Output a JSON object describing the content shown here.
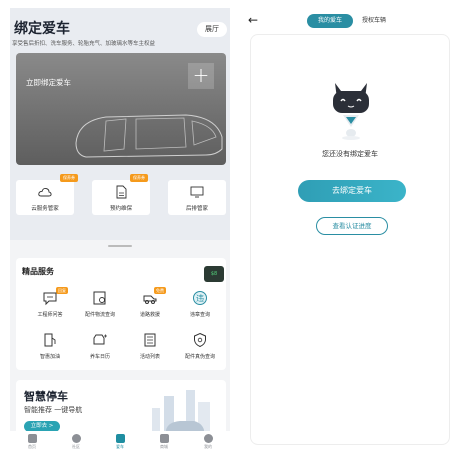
{
  "left": {
    "title": "绑定爱车",
    "subtitle": "享受售后折扣、洗车服务、轮胎充气、加玻璃水等车主权益",
    "hall_label": "展厅",
    "car_card_label": "立即绑定爱车",
    "services": [
      {
        "label": "云服务管家",
        "badge": "",
        "icon": "cloud-icon"
      },
      {
        "label": "预约维保",
        "badge": "保养券",
        "icon": "document-icon"
      },
      {
        "label": "后排管家",
        "badge": "",
        "icon": "monitor-icon"
      }
    ],
    "service_badge_left": "保养券",
    "premium_title": "精品服务",
    "premium_items": [
      {
        "label": "工程师问答",
        "icon": "chat-icon",
        "badge": "回复"
      },
      {
        "label": "配件物流查询",
        "icon": "parts-search-icon",
        "badge": ""
      },
      {
        "label": "道路救援",
        "icon": "tow-truck-icon",
        "badge": "免费"
      },
      {
        "label": "违章查询",
        "icon": "violation-icon",
        "badge": ""
      },
      {
        "label": "智惠加油",
        "icon": "fuel-icon",
        "badge": ""
      },
      {
        "label": "养车日历",
        "icon": "calendar-car-icon",
        "badge": ""
      },
      {
        "label": "活动列表",
        "icon": "list-icon",
        "badge": ""
      },
      {
        "label": "配件真伪查询",
        "icon": "shield-check-icon",
        "badge": ""
      }
    ],
    "float_chip": "$8",
    "parking": {
      "title": "智慧停车",
      "subtitle": "智能推荐 一键导航",
      "button": "立即去 >"
    },
    "tabbar": [
      {
        "label": "首页",
        "active": false
      },
      {
        "label": "社区",
        "active": false
      },
      {
        "label": "爱车",
        "active": true
      },
      {
        "label": "商城",
        "active": false
      },
      {
        "label": "我的",
        "active": false
      }
    ]
  },
  "right": {
    "back_icon": "back-arrow-icon",
    "tab_active": "我的爱车",
    "tab_inactive": "授权车辆",
    "empty_message": "您还没有绑定爱车",
    "bind_button": "去绑定爱车",
    "progress_button": "查看认证进度"
  },
  "colors": {
    "accent": "#2a8ea3",
    "badge": "#f59a1c",
    "panel_bg": "#e9ecf1"
  }
}
